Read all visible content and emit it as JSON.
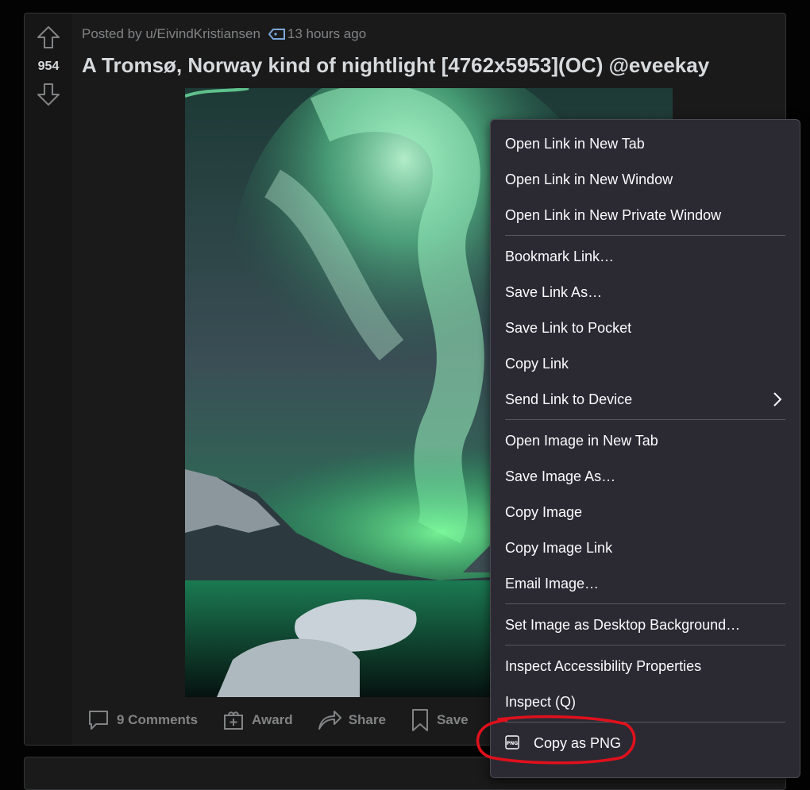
{
  "post": {
    "vote_count": "954",
    "posted_by": "Posted by u/EivindKristiansen",
    "time_ago": "13 hours ago",
    "title": "A Tromsø, Norway kind of nightlight [4762x5953](OC) @eveekay",
    "actions": {
      "comments": "9 Comments",
      "award": "Award",
      "share": "Share",
      "save": "Save"
    }
  },
  "context_menu": {
    "items": [
      {
        "label": "Open Link in New Tab"
      },
      {
        "label": "Open Link in New Window"
      },
      {
        "label": "Open Link in New Private Window"
      },
      {
        "label": "Bookmark Link…"
      },
      {
        "label": "Save Link As…"
      },
      {
        "label": "Save Link to Pocket"
      },
      {
        "label": "Copy Link"
      },
      {
        "label": "Send Link to Device"
      },
      {
        "label": "Open Image in New Tab"
      },
      {
        "label": "Save Image As…"
      },
      {
        "label": "Copy Image"
      },
      {
        "label": "Copy Image Link"
      },
      {
        "label": "Email Image…"
      },
      {
        "label": "Set Image as Desktop Background…"
      },
      {
        "label": "Inspect Accessibility Properties"
      },
      {
        "label": "Inspect (Q)"
      },
      {
        "label": "Copy as PNG",
        "icon": "png-icon"
      }
    ]
  },
  "colors": {
    "menu_bg": "#2b2a33",
    "post_bg": "#1a1a1b",
    "highlight": "#e0101c"
  }
}
